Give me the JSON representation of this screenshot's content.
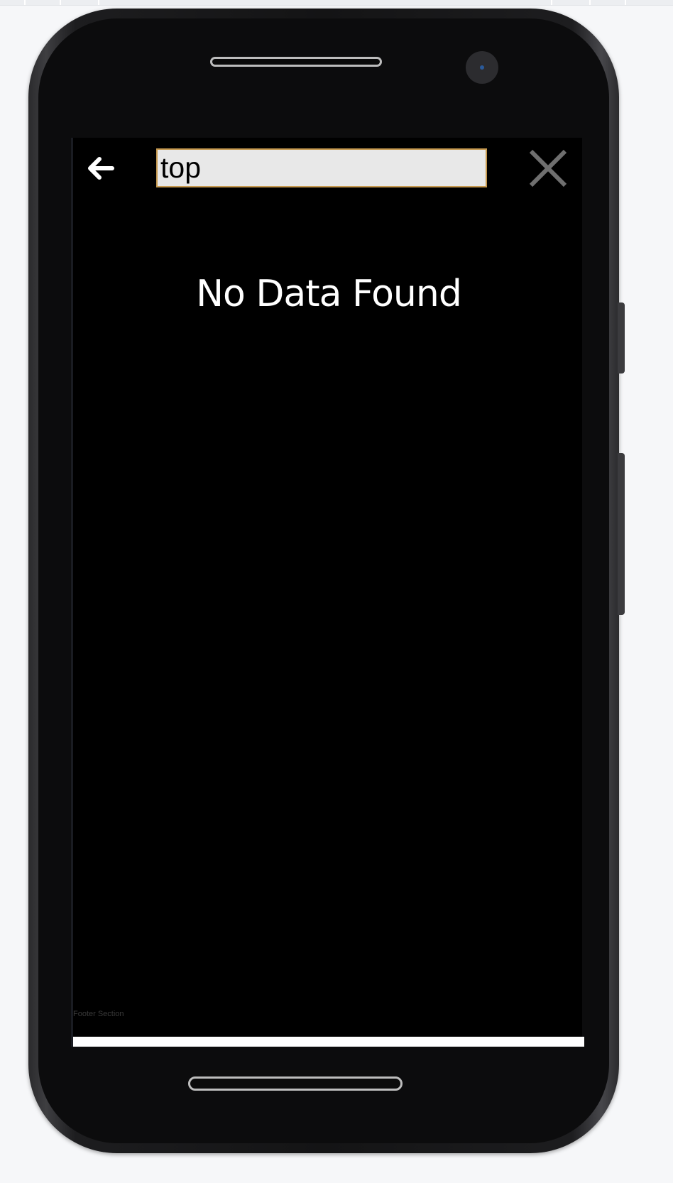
{
  "search": {
    "value": "top",
    "placeholder": ""
  },
  "result": {
    "empty_message": "No Data Found"
  },
  "footer": {
    "label": "Footer Section"
  },
  "icons": {
    "back": "arrow-left-icon",
    "close": "close-icon"
  },
  "colors": {
    "screen_background": "#000000",
    "input_background": "#e8e8e8",
    "input_border": "#c79a50",
    "close_icon": "#6f6f6f",
    "back_icon": "#ffffff"
  }
}
